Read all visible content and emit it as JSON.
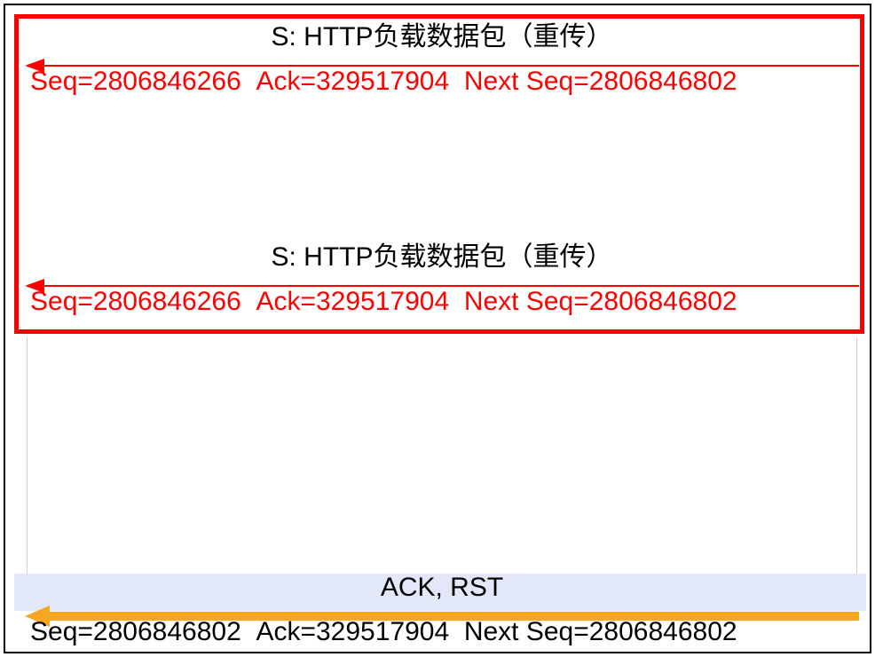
{
  "messages": {
    "retrans1": {
      "title": "S: HTTP负载数据包（重传）",
      "seq_label": "Seq=",
      "seq": "2806846266",
      "ack_label": "Ack=",
      "ack": "329517904",
      "next_label": "Next Seq=",
      "next": "2806846802"
    },
    "retrans2": {
      "title": "S: HTTP负载数据包（重传）",
      "seq_label": "Seq=",
      "seq": "2806846266",
      "ack_label": "Ack=",
      "ack": "329517904",
      "next_label": "Next Seq=",
      "next": "2806846802"
    },
    "ackrst": {
      "title": "ACK, RST",
      "seq_label": "Seq=",
      "seq": "2806846802",
      "ack_label": "Ack=",
      "ack": "329517904",
      "next_label": "Next Seq=",
      "next": "2806846802"
    }
  },
  "colors": {
    "highlight": "#ff0000",
    "arrow_orange": "#f5a623",
    "selection_bg": "#e2e8f7"
  }
}
